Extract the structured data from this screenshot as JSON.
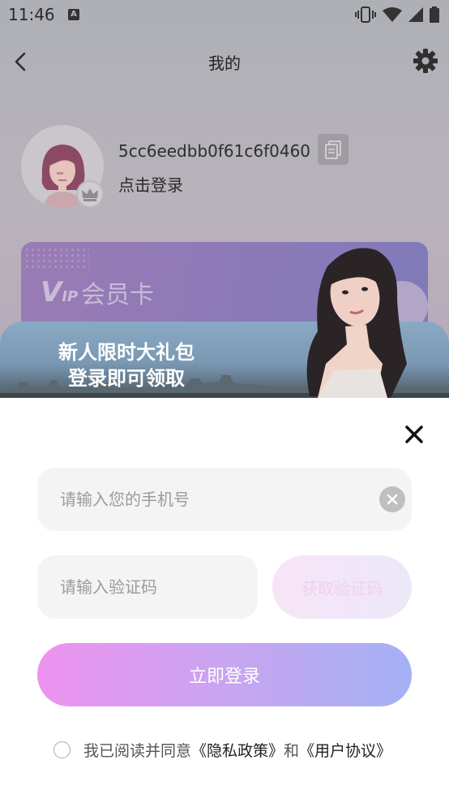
{
  "status_bar": {
    "time": "11:46",
    "badge": "A"
  },
  "header": {
    "title": "我的"
  },
  "profile": {
    "user_id": "5cc6eedbb0f61c6f0460",
    "login_hint": "点击登录"
  },
  "vip_card": {
    "logo": "V",
    "logo_suffix": "IP",
    "title": "会员卡"
  },
  "promo": {
    "line1": "新人限时大礼包",
    "line2": "登录即可领取"
  },
  "login_form": {
    "phone_placeholder": "请输入您的手机号",
    "code_placeholder": "请输入验证码",
    "get_code_label": "获取验证码",
    "login_label": "立即登录",
    "agree_prefix": "我已阅读并同意",
    "privacy_link": "《隐私政策》",
    "agree_and": "和",
    "terms_link": "《用户协议》"
  },
  "colors": {
    "login_gradient_start": "#ed93ef",
    "login_gradient_end": "#a4b1f4",
    "field_bg": "#f4f4f5"
  }
}
